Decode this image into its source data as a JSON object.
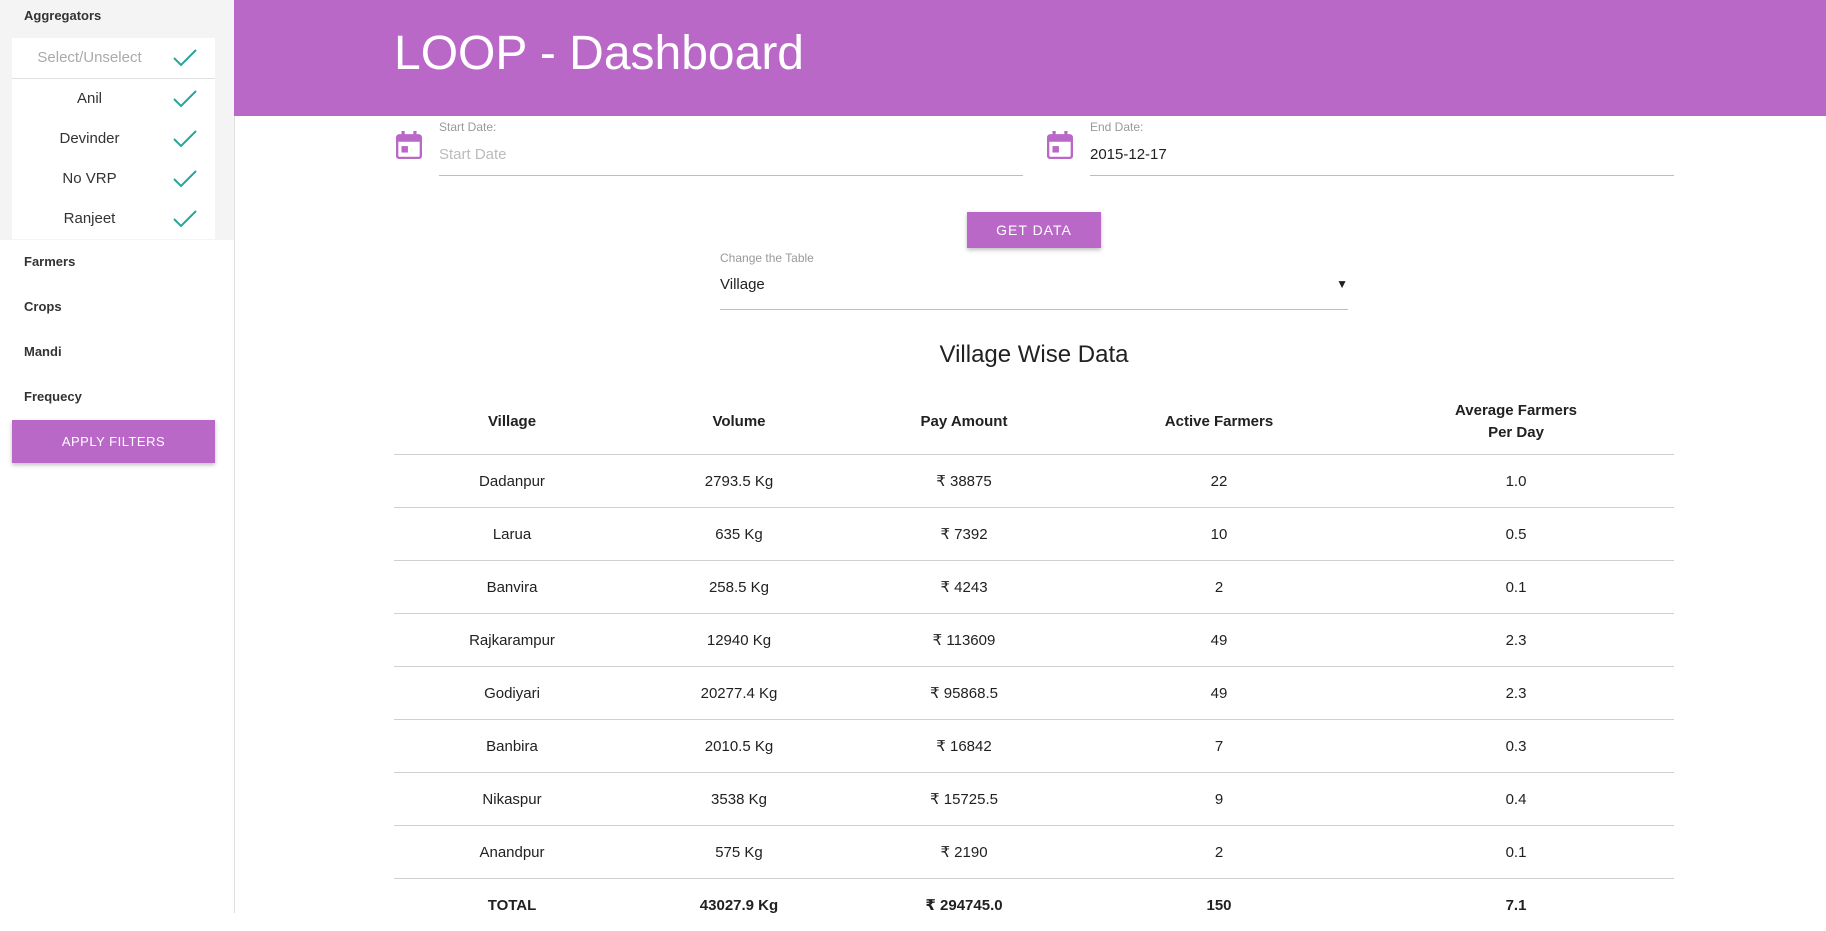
{
  "sidebar": {
    "aggregators_label": "Aggregators",
    "select_all_label": "Select/Unselect",
    "aggregators": [
      "Anil",
      "Devinder",
      "No VRP",
      "Ranjeet"
    ],
    "farmers_label": "Farmers",
    "crops_label": "Crops",
    "mandi_label": "Mandi",
    "frequency_label": "Frequecy",
    "apply_button": "APPLY FILTERS"
  },
  "header": {
    "title": "LOOP - Dashboard"
  },
  "filters": {
    "start_date_label": "Start Date:",
    "start_date_placeholder": "Start Date",
    "start_date_value": "",
    "end_date_label": "End Date:",
    "end_date_value": "2015-12-17",
    "get_data_button": "GET DATA",
    "table_select_label": "Change the Table",
    "table_select_value": "Village"
  },
  "table": {
    "title": "Village Wise Data",
    "columns": [
      "Village",
      "Volume",
      "Pay Amount",
      "Active Farmers",
      "Average Farmers",
      "Per Day"
    ],
    "rows": [
      [
        "Dadanpur",
        "2793.5 Kg",
        "₹ 38875",
        "22",
        "1.0"
      ],
      [
        "Larua",
        "635 Kg",
        "₹ 7392",
        "10",
        "0.5"
      ],
      [
        "Banvira",
        "258.5 Kg",
        "₹ 4243",
        "2",
        "0.1"
      ],
      [
        "Rajkarampur",
        "12940 Kg",
        "₹ 113609",
        "49",
        "2.3"
      ],
      [
        "Godiyari",
        "20277.4 Kg",
        "₹ 95868.5",
        "49",
        "2.3"
      ],
      [
        "Banbira",
        "2010.5 Kg",
        "₹ 16842",
        "7",
        "0.3"
      ],
      [
        "Nikaspur",
        "3538 Kg",
        "₹ 15725.5",
        "9",
        "0.4"
      ],
      [
        "Anandpur",
        "575 Kg",
        "₹ 2190",
        "2",
        "0.1"
      ]
    ],
    "total": [
      "TOTAL",
      "43027.9 Kg",
      "₹ 294745.0",
      "150",
      "7.1"
    ]
  },
  "colors": {
    "accent": "#ba68c8",
    "check": "#26a69a"
  },
  "icons": {
    "check": "check-icon",
    "calendar": "calendar-icon",
    "dropdown": "dropdown-arrow-icon"
  }
}
